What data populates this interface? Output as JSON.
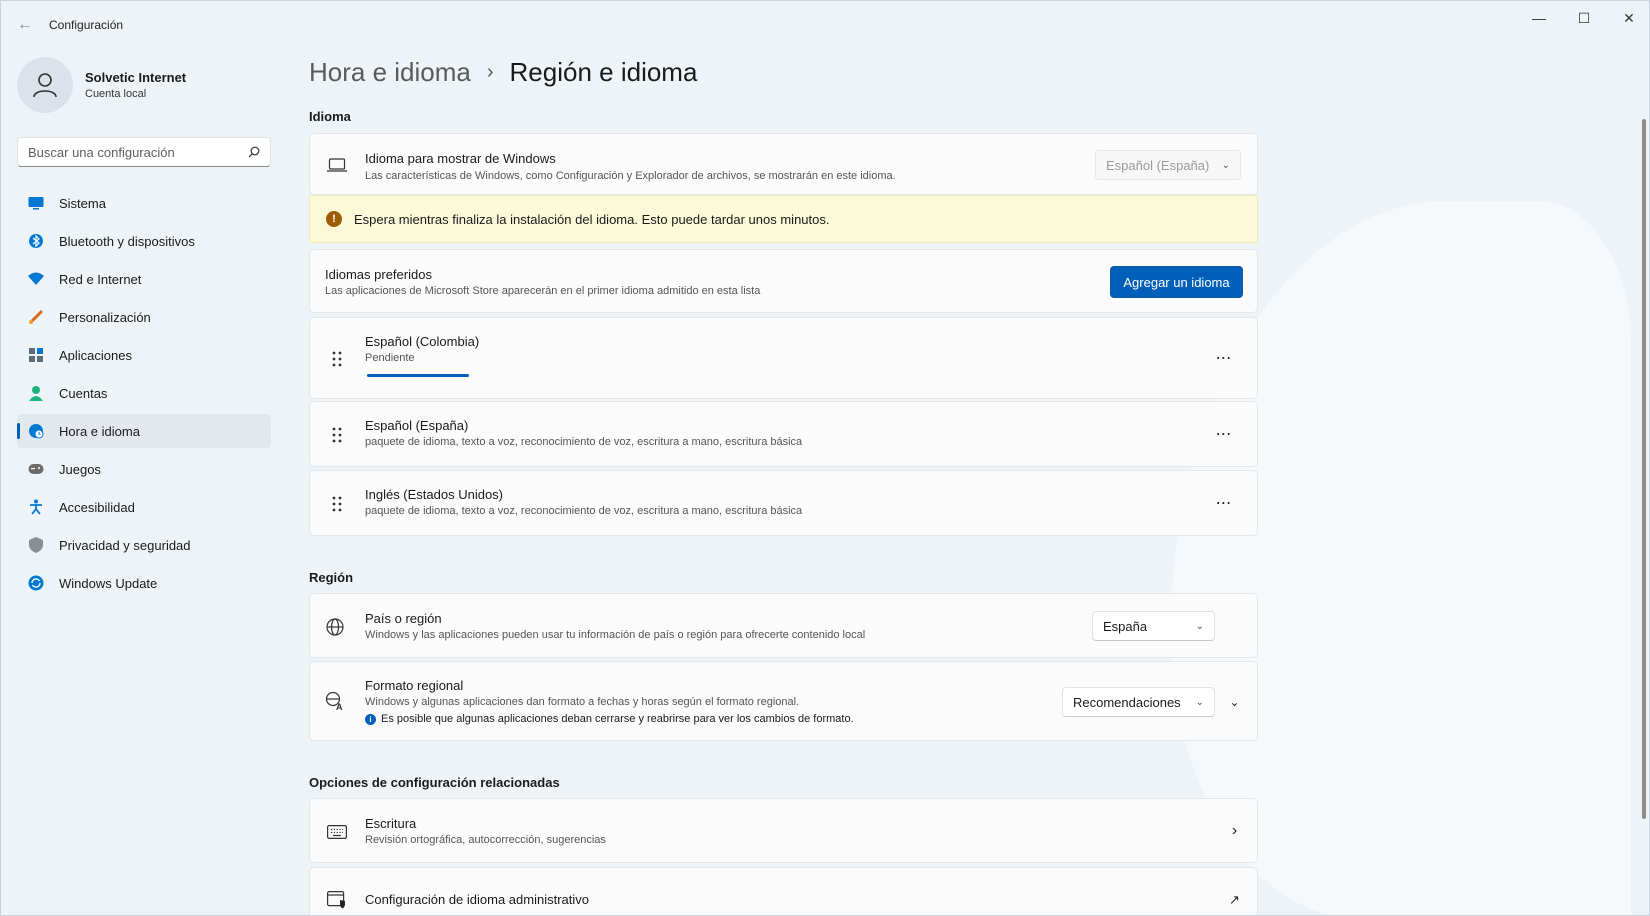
{
  "window": {
    "title": "Configuración",
    "controls": {
      "minimize": "—",
      "maximize": "☐",
      "close": "✕"
    }
  },
  "profile": {
    "name": "Solvetic Internet",
    "account": "Cuenta local"
  },
  "search": {
    "placeholder": "Buscar una configuración"
  },
  "sidebar": {
    "items": [
      {
        "label": "Sistema",
        "icon": "monitor-icon",
        "color": "#0078d4"
      },
      {
        "label": "Bluetooth y dispositivos",
        "icon": "bluetooth-icon",
        "color": "#0078d4"
      },
      {
        "label": "Red e Internet",
        "icon": "wifi-icon",
        "color": "#0078d4"
      },
      {
        "label": "Personalización",
        "icon": "brush-icon",
        "color": "#d2691e"
      },
      {
        "label": "Aplicaciones",
        "icon": "apps-icon",
        "color": "#5c6b7a"
      },
      {
        "label": "Cuentas",
        "icon": "person-icon",
        "color": "#1db37c"
      },
      {
        "label": "Hora e idioma",
        "icon": "globe-clock-icon",
        "color": "#0078d4",
        "active": true
      },
      {
        "label": "Juegos",
        "icon": "gamepad-icon",
        "color": "#6b6b6b"
      },
      {
        "label": "Accesibilidad",
        "icon": "accessibility-icon",
        "color": "#0078d4"
      },
      {
        "label": "Privacidad y seguridad",
        "icon": "shield-icon",
        "color": "#6b6b6b"
      },
      {
        "label": "Windows Update",
        "icon": "update-icon",
        "color": "#0078d4"
      }
    ]
  },
  "breadcrumb": {
    "parent": "Hora e idioma",
    "separator": "›",
    "current": "Región e idioma"
  },
  "idioma": {
    "section_title": "Idioma",
    "display_language": {
      "title": "Idioma para mostrar de Windows",
      "subtitle": "Las características de Windows, como Configuración y Explorador de archivos, se mostrarán en este idioma.",
      "value": "Español (España)"
    },
    "warning": "Espera mientras finaliza la instalación del idioma. Esto puede tardar unos minutos.",
    "preferred": {
      "title": "Idiomas preferidos",
      "subtitle": "Las aplicaciones de Microsoft Store aparecerán en el primer idioma admitido en esta lista",
      "add_button": "Agregar un idioma"
    },
    "languages": [
      {
        "name": "Español (Colombia)",
        "detail": "Pendiente",
        "progress": 0.3
      },
      {
        "name": "Español (España)",
        "detail": "paquete de idioma, texto a voz, reconocimiento de voz, escritura a mano, escritura básica"
      },
      {
        "name": "Inglés (Estados Unidos)",
        "detail": "paquete de idioma, texto a voz, reconocimiento de voz, escritura a mano, escritura básica"
      }
    ]
  },
  "region": {
    "section_title": "Región",
    "country": {
      "title": "País o región",
      "subtitle": "Windows y las aplicaciones pueden usar tu información de país o región para ofrecerte contenido local",
      "value": "España"
    },
    "format": {
      "title": "Formato regional",
      "subtitle": "Windows y algunas aplicaciones dan formato a fechas y horas según el formato regional.",
      "info": "Es posible que algunas aplicaciones deban cerrarse y reabrirse para ver los cambios de formato.",
      "value": "Recomendaciones"
    }
  },
  "related": {
    "section_title": "Opciones de configuración relacionadas",
    "typing": {
      "title": "Escritura",
      "subtitle": "Revisión ortográfica, autocorrección, sugerencias"
    },
    "admin": {
      "title": "Configuración de idioma administrativo"
    }
  }
}
